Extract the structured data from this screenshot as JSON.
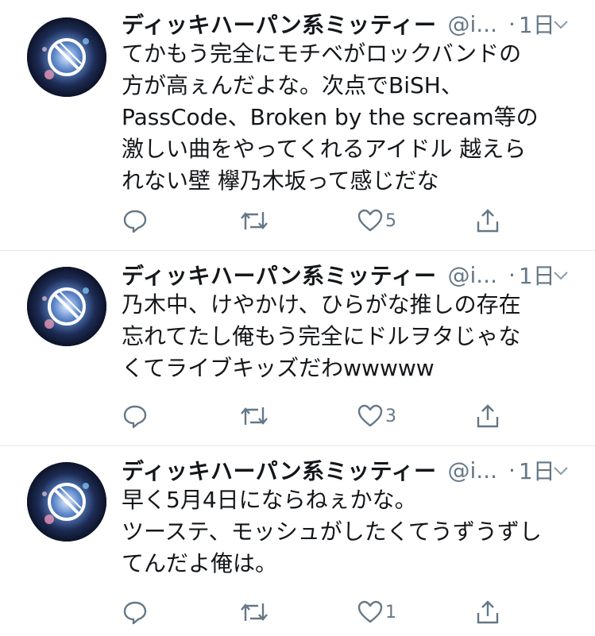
{
  "colors": {
    "text": "#14171a",
    "muted": "#657786",
    "divider": "#e1e8ed"
  },
  "icons": {
    "avatar": "anime-artwork-avatar",
    "menu": "chevron-down-icon",
    "reply": "reply-icon",
    "retweet": "retweet-icon",
    "like": "heart-icon",
    "share": "share-icon"
  },
  "tweets": [
    {
      "name": "ディッキハーパン系ミッティー",
      "handle": "@i...",
      "dot": "·",
      "time": "1日",
      "text": "てかもう完全にモチベがロックバンドの\n方が高ぇんだよな。次点でBiSH、\nPassCode、Broken by the scream等の\n激しい曲をやってくれるアイドル 越えら\nれない壁 欅乃木坂って感じだな",
      "likes": "5"
    },
    {
      "name": "ディッキハーパン系ミッティー",
      "handle": "@i...",
      "dot": "·",
      "time": "1日",
      "text": "乃木中、けやかけ、ひらがな推しの存在\n忘れてたし俺もう完全にドルヲタじゃな\nくてライブキッズだわwwwww",
      "likes": "3"
    },
    {
      "name": "ディッキハーパン系ミッティー",
      "handle": "@i...",
      "dot": "·",
      "time": "1日",
      "text": "早く5月4日にならねぇかな。\nツーステ、モッシュがしたくてうずうずし\nてんだよ俺は。",
      "likes": "1"
    }
  ]
}
